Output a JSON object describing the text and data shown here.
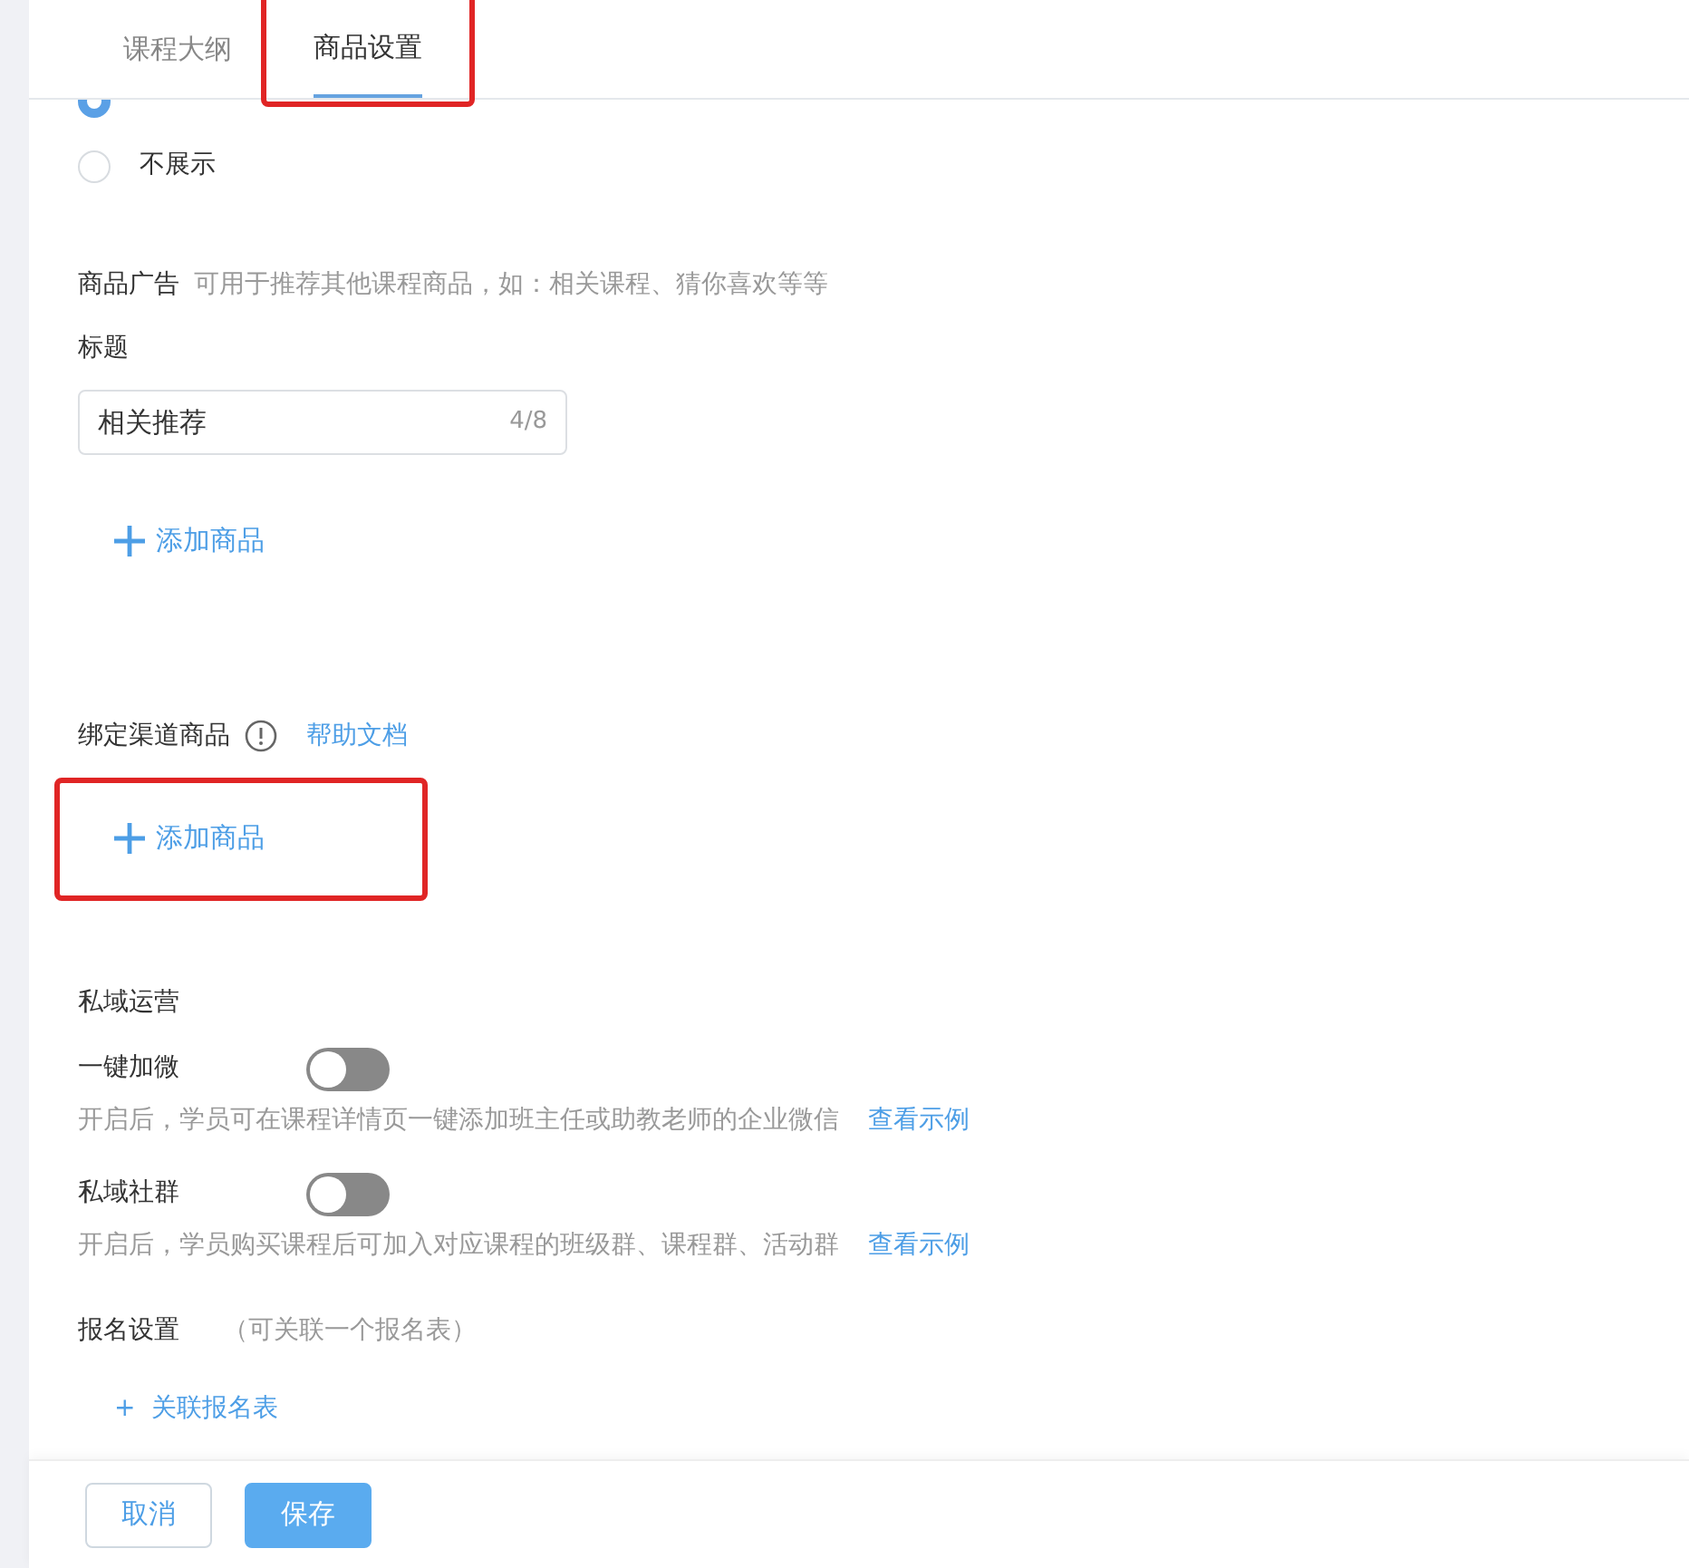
{
  "tabs": [
    {
      "label": "课程大纲",
      "selected": false,
      "highlighted": false
    },
    {
      "label": "商品设置",
      "selected": true,
      "highlighted": true
    }
  ],
  "display_options": [
    {
      "selected": true
    },
    {
      "label": "不展示",
      "selected": false
    }
  ],
  "product_ad": {
    "title": "商品广告",
    "hint": "可用于推荐其他课程商品，如：相关课程、猜你喜欢等等",
    "field_label": "标题",
    "field_value": "相关推荐",
    "counter": "4/8",
    "add_button": {
      "label": "添加商品",
      "highlighted": false
    }
  },
  "channel_products": {
    "title": "绑定渠道商品",
    "help_link": "帮助文档",
    "add_button": {
      "label": "添加商品",
      "highlighted": true
    }
  },
  "private_ops": {
    "title": "私域运营",
    "toggles": [
      {
        "label": "一键加微",
        "on": false,
        "description": "开启后，学员可在课程详情页一键添加班主任或助教老师的企业微信",
        "link": "查看示例"
      },
      {
        "label": "私域社群",
        "on": false,
        "description": "开启后，学员购买课程后可加入对应课程的班级群、课程群、活动群",
        "link": "查看示例"
      }
    ]
  },
  "signup": {
    "title": "报名设置",
    "hint": "（可关联一个报名表）",
    "plus": "+",
    "link": "关联报名表"
  },
  "footer_buttons": [
    {
      "label": "取消",
      "kind": "secondary"
    },
    {
      "label": "保存",
      "kind": "primary"
    }
  ]
}
